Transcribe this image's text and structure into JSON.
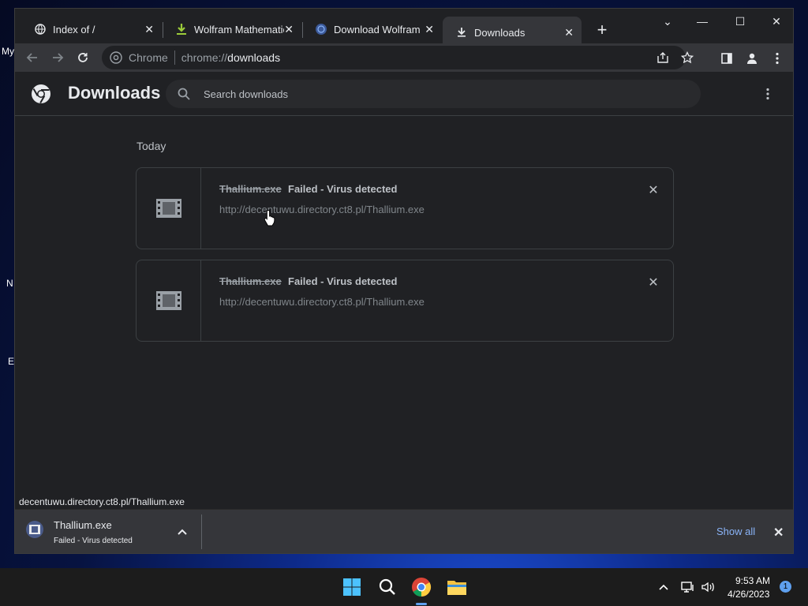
{
  "desktop": {
    "fragments": [
      "My",
      "N",
      "E"
    ]
  },
  "tabs": [
    {
      "title": "Index of /",
      "icon": "globe-icon"
    },
    {
      "title": "Wolfram Mathematica",
      "icon": "download-arrow-icon"
    },
    {
      "title": "Download Wolfram M",
      "icon": "wolfram-icon"
    },
    {
      "title": "Downloads",
      "icon": "download-icon",
      "active": true
    }
  ],
  "window_controls": {
    "tab_search": "⌄",
    "minimize": "—",
    "maximize": "☐",
    "close": "✕"
  },
  "omnibox": {
    "site_label": "Chrome",
    "url_scheme": "chrome://",
    "url_host": "downloads"
  },
  "page": {
    "title": "Downloads",
    "search_placeholder": "Search downloads",
    "section": "Today",
    "items": [
      {
        "filename": "Thallium.exe",
        "status": "Failed - Virus detected",
        "url": "http://decentuwu.directory.ct8.pl/Thallium.exe"
      },
      {
        "filename": "Thallium.exe",
        "status": "Failed - Virus detected",
        "url": "http://decentuwu.directory.ct8.pl/Thallium.exe"
      }
    ]
  },
  "status_bubble": "decentuwu.directory.ct8.pl/Thallium.exe",
  "shelf": {
    "filename": "Thallium.exe",
    "status": "Failed - Virus detected",
    "show_all": "Show all"
  },
  "taskbar": {
    "time": "9:53 AM",
    "date": "4/26/2023",
    "notifications": "1"
  },
  "colors": {
    "accent": "#8ab4f8",
    "background": "#202124",
    "toolbar": "#35363a"
  }
}
